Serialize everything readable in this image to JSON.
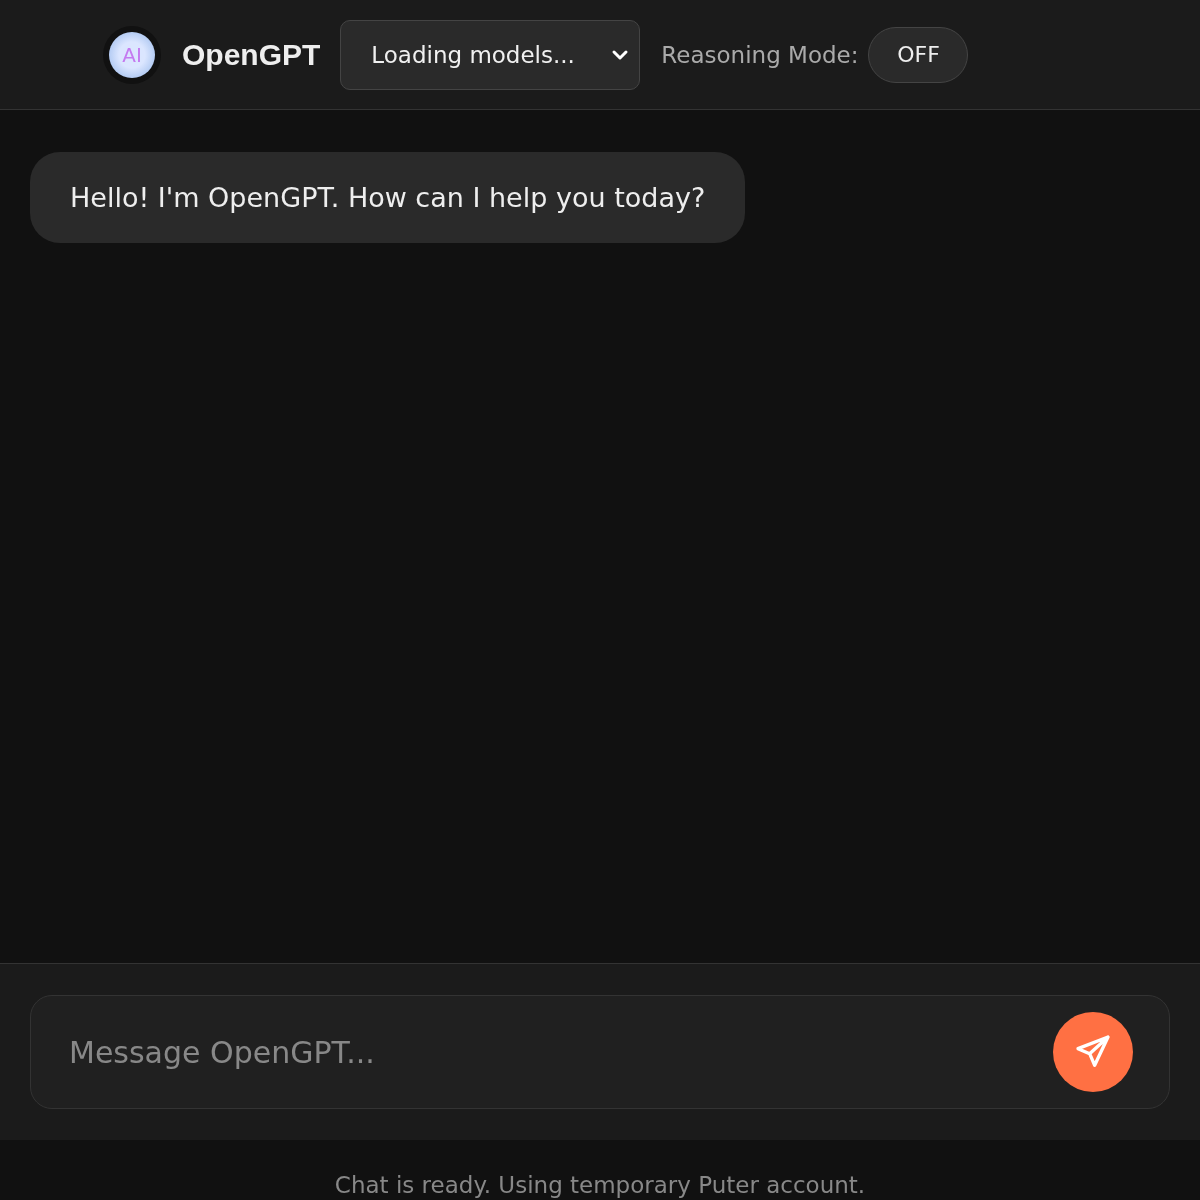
{
  "header": {
    "logo_text": "AI",
    "title": "OpenGPT",
    "model_select": {
      "value": "Loading models..."
    },
    "reasoning": {
      "label": "Reasoning Mode:",
      "toggle": "OFF",
      "on": false
    }
  },
  "messages": [
    {
      "kind": "assistant",
      "text": "Hello! I'm OpenGPT. How can I help you today?"
    }
  ],
  "composer": {
    "placeholder": "Message OpenGPT..."
  },
  "status_bar": "Chat is ready. Using temporary Puter account."
}
